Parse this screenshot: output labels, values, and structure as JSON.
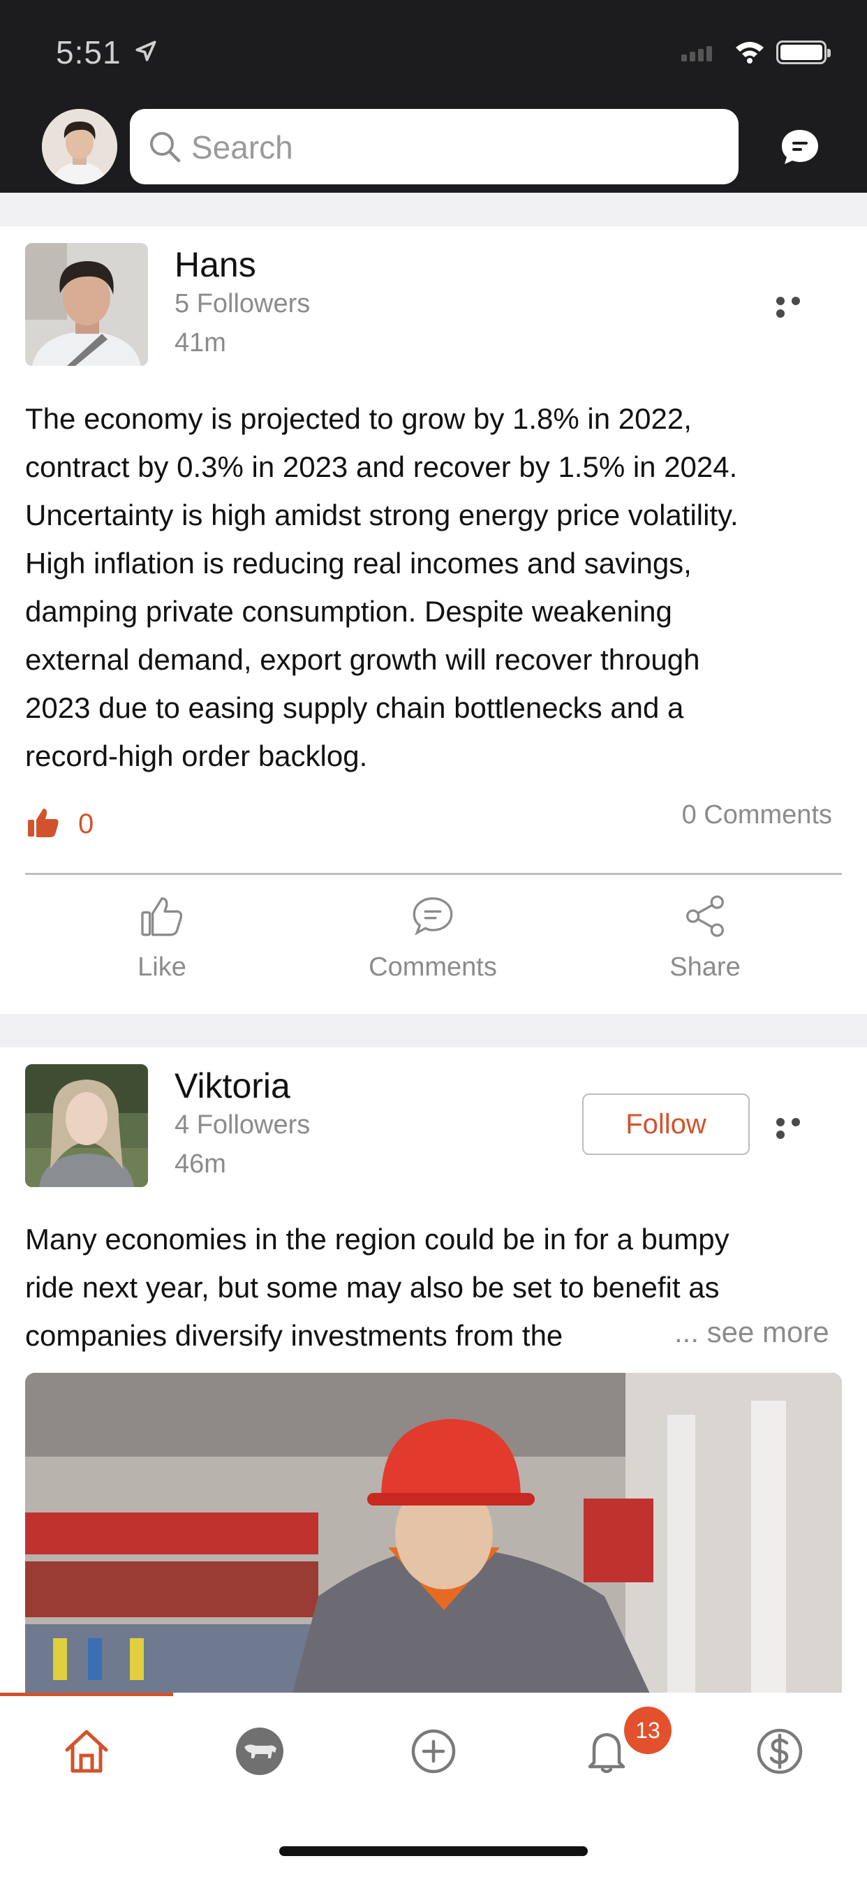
{
  "status_bar": {
    "time": "5:51"
  },
  "search": {
    "placeholder": "Search"
  },
  "colors": {
    "accent": "#d2532b",
    "header_bg": "#1c1c1e",
    "badge": "#e3502c"
  },
  "posts": [
    {
      "author": "Hans",
      "followers": "5 Followers",
      "time": "41m",
      "text_lines": [
        "The economy is projected to grow by 1.8% in 2022,",
        "contract by 0.3% in 2023 and recover by 1.5% in 2024.",
        "Uncertainty is high amidst strong energy price volatility.",
        "High inflation is reducing real incomes and savings,",
        "damping private consumption. Despite weakening",
        "external demand, export growth will recover through",
        "2023 due to easing supply chain bottlenecks and a",
        "record-high order backlog."
      ],
      "likes": "0",
      "comments": "0 Comments",
      "actions": {
        "like": "Like",
        "comments": "Comments",
        "share": "Share"
      }
    },
    {
      "author": "Viktoria",
      "followers": "4 Followers",
      "time": "46m",
      "follow_label": "Follow",
      "text_lines": [
        "Many economies in the region could be in for a bumpy",
        "ride next year, but some may also be set to benefit as",
        "companies diversify investments from the"
      ],
      "see_more": "... see more"
    }
  ],
  "tabbar": {
    "items": [
      "home-icon",
      "bull-icon",
      "add-icon",
      "bell-icon",
      "dollar-icon"
    ],
    "notifications_badge": "13"
  }
}
